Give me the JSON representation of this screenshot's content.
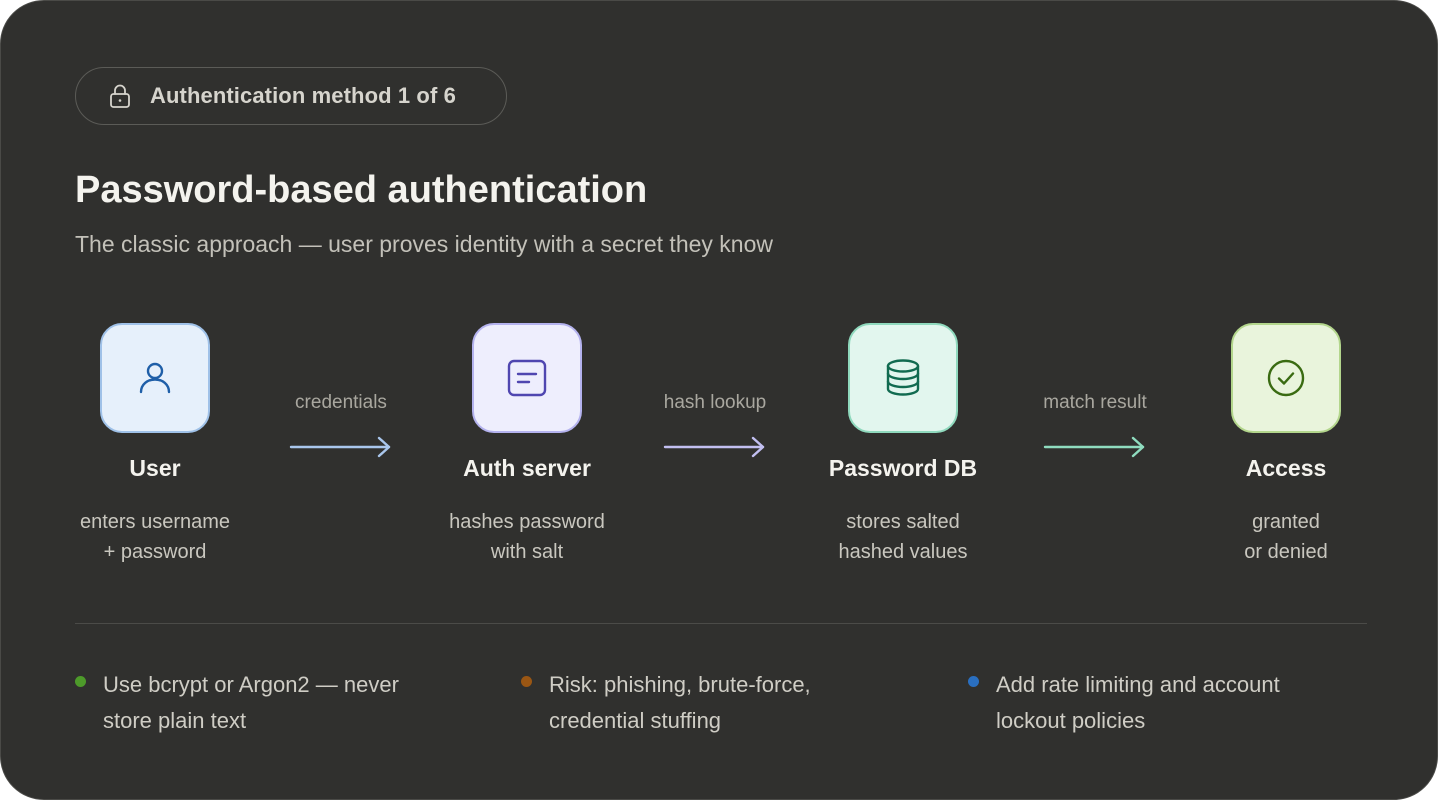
{
  "badge": {
    "icon": "lock-icon",
    "text": "Authentication method 1 of 6"
  },
  "header": {
    "title": "Password-based authentication",
    "subtitle": "The classic approach — user proves identity with a secret they know"
  },
  "flow": {
    "nodes": [
      {
        "icon": "user-icon",
        "label": "User",
        "desc_line1": "enters username",
        "desc_line2": "+ password",
        "tile_bg": "#e6f0fb",
        "tile_border": "#9fc1e8",
        "icon_color": "#1f5fa8"
      },
      {
        "icon": "server-icon",
        "label": "Auth server",
        "desc_line1": "hashes password",
        "desc_line2": "with salt",
        "tile_bg": "#eeeefd",
        "tile_border": "#b4b2ee",
        "icon_color": "#4f46b0"
      },
      {
        "icon": "database-icon",
        "label": "Password DB",
        "desc_line1": "stores salted",
        "desc_line2": "hashed values",
        "tile_bg": "#e2f6ee",
        "tile_border": "#8fd9bd",
        "icon_color": "#116b50"
      },
      {
        "icon": "check-circle-icon",
        "label": "Access",
        "desc_line1": "granted",
        "desc_line2": "or denied",
        "tile_bg": "#e9f4dc",
        "tile_border": "#b3d68c",
        "icon_color": "#3a6b12"
      }
    ],
    "edges": [
      {
        "label": "credentials",
        "color": "#a9c6ec"
      },
      {
        "label": "hash lookup",
        "color": "#c2bff1"
      },
      {
        "label": "match result",
        "color": "#8fdcbf"
      }
    ]
  },
  "notes": [
    {
      "line1": "Use bcrypt or Argon2 — never",
      "line2": "store plain text",
      "dot_color": "#4d9a2a"
    },
    {
      "line1": "Risk: phishing, brute-force,",
      "line2": "credential stuffing",
      "dot_color": "#9a5613"
    },
    {
      "line1": "Add rate limiting and account",
      "line2": "lockout policies",
      "dot_color": "#2a6fc0"
    }
  ]
}
